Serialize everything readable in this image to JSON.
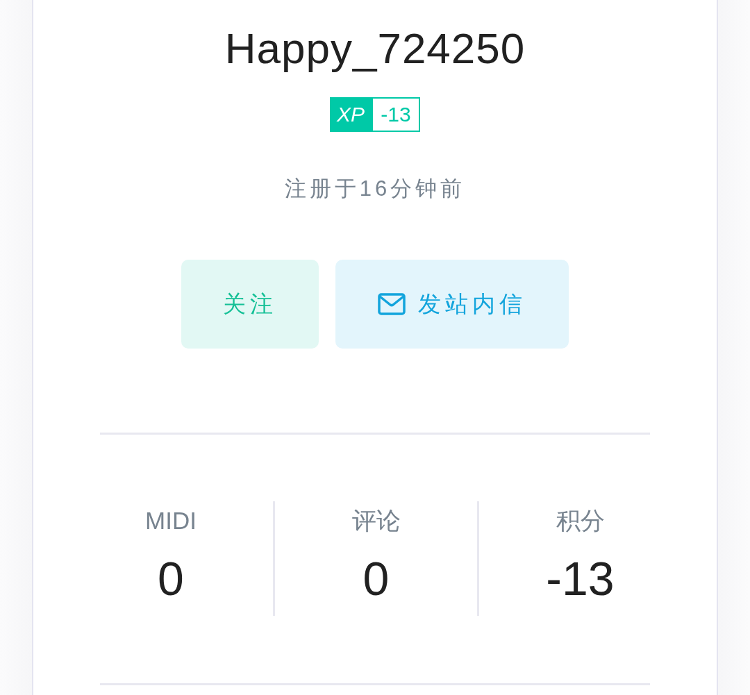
{
  "user": {
    "name": "Happy_724250",
    "xp": {
      "label": "XP",
      "value": "-13"
    },
    "registered": "注册于16分钟前"
  },
  "actions": [
    {
      "kind": "follow",
      "label": "关注"
    },
    {
      "kind": "message",
      "label": "发站内信"
    }
  ],
  "stats": [
    {
      "label": "MIDI",
      "value": "0"
    },
    {
      "label": "评论",
      "value": "0"
    },
    {
      "label": "积分",
      "value": "-13"
    }
  ]
}
